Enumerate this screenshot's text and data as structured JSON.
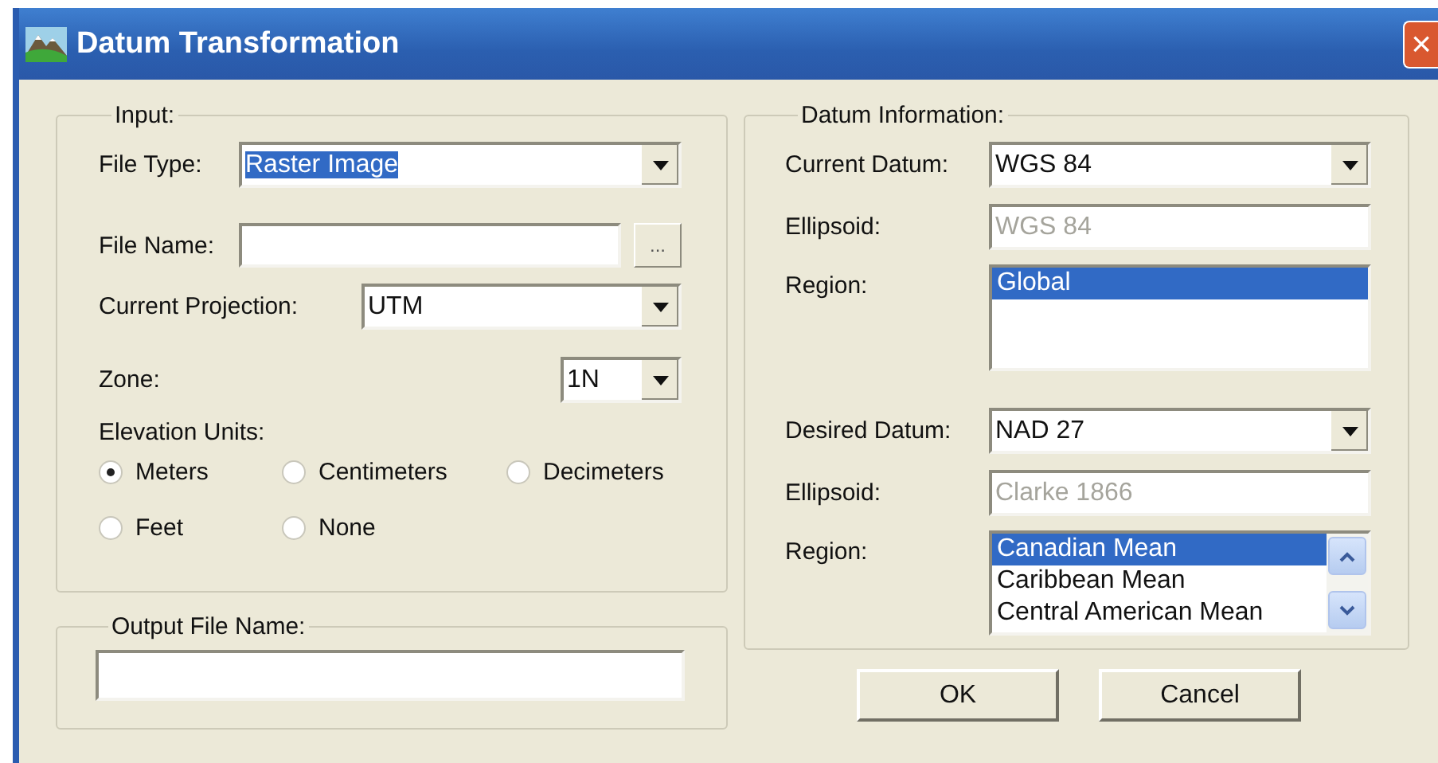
{
  "window": {
    "title": "Datum Transformation",
    "close": "×"
  },
  "input": {
    "title": "Input:",
    "file_type": {
      "label": "File Type:",
      "value": "Raster Image",
      "focused": true
    },
    "file_name": {
      "label": "File Name:",
      "browse": "..."
    },
    "projection": {
      "label": "Current Projection:",
      "value": "UTM"
    },
    "zone": {
      "label": "Zone:",
      "value": "1N"
    },
    "elevation_units": {
      "label": "Elevation Units:",
      "options": [
        {
          "label": "Meters",
          "selected": true
        },
        {
          "label": "Centimeters",
          "selected": false
        },
        {
          "label": "Decimeters",
          "selected": false
        },
        {
          "label": "Feet",
          "selected": false
        },
        {
          "label": "None",
          "selected": false
        }
      ]
    }
  },
  "output": {
    "title": "Output File Name:"
  },
  "datum": {
    "title": "Datum Information:",
    "sections": [
      {
        "datum_label": "Current Datum:",
        "datum": "WGS 84",
        "ellipsoid_label": "Ellipsoid:",
        "ellipsoid": "WGS 84",
        "ellipsoid_disabled": true,
        "region_label": "Region:",
        "scrollbar": false,
        "regions": [
          {
            "label": "Global",
            "selected": true
          }
        ]
      },
      {
        "datum_label": "Desired Datum:",
        "datum": "NAD 27",
        "ellipsoid_label": "Ellipsoid:",
        "ellipsoid": "Clarke 1866",
        "ellipsoid_disabled": true,
        "region_label": "Region:",
        "scrollbar": true,
        "regions": [
          {
            "label": "Canadian Mean",
            "selected": true
          },
          {
            "label": "Caribbean Mean",
            "selected": false
          },
          {
            "label": "Central American Mean",
            "selected": false
          }
        ]
      }
    ]
  },
  "buttons": [
    "OK",
    "Cancel"
  ]
}
